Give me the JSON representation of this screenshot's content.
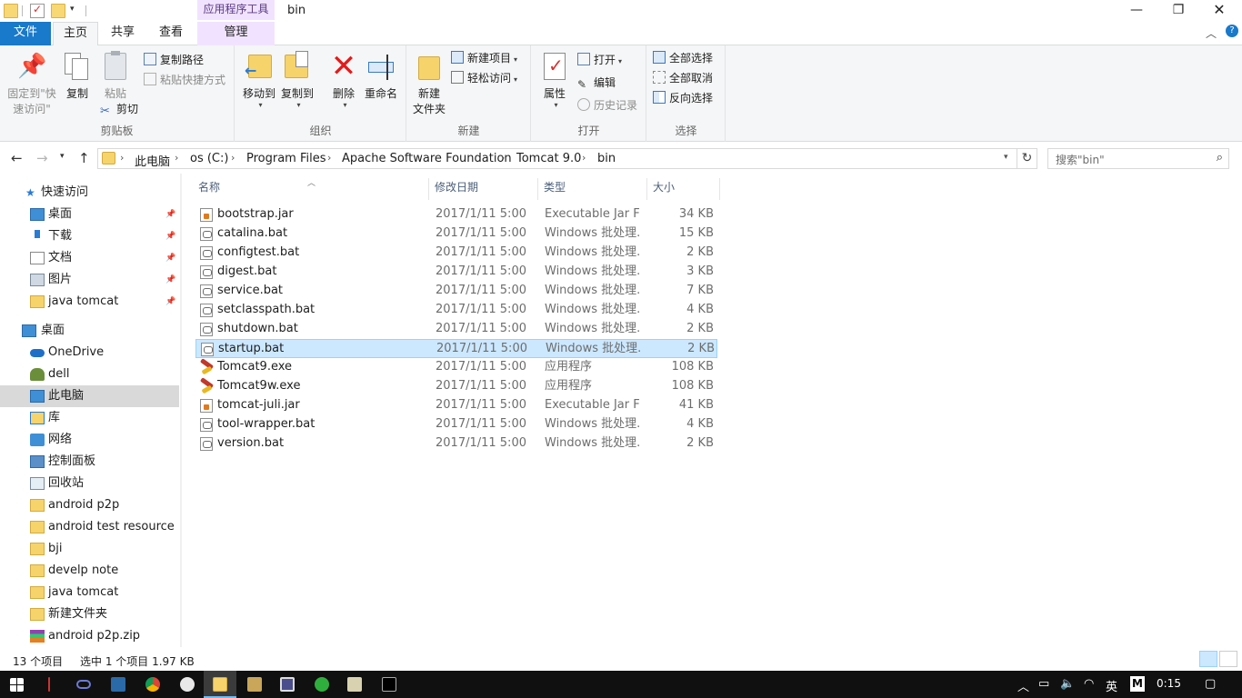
{
  "window": {
    "title": "bin",
    "context_tab_title": "应用程序工具",
    "minimize_icon": "minimize-icon",
    "maximize_icon": "restore-icon",
    "close_icon": "close-icon"
  },
  "ribbon_tabs": {
    "file": "文件",
    "home": "主页",
    "share": "共享",
    "view": "查看",
    "manage": "管理",
    "active": "主页"
  },
  "ribbon": {
    "clipboard": {
      "label": "剪贴板",
      "pin_quick_access_line1": "固定到\"快",
      "pin_quick_access_line2": "速访问\"",
      "copy": "复制",
      "paste": "粘贴",
      "copy_path": "复制路径",
      "paste_shortcut": "粘贴快捷方式",
      "cut": "剪切"
    },
    "organize": {
      "label": "组织",
      "move_to": "移动到",
      "copy_to": "复制到",
      "delete": "删除",
      "rename": "重命名"
    },
    "new": {
      "label": "新建",
      "new_folder_line1": "新建",
      "new_folder_line2": "文件夹",
      "new_item": "新建项目",
      "easy_access": "轻松访问"
    },
    "open": {
      "label": "打开",
      "properties": "属性",
      "open": "打开",
      "edit": "编辑",
      "history": "历史记录"
    },
    "select": {
      "label": "选择",
      "select_all": "全部选择",
      "select_none": "全部取消",
      "invert_selection": "反向选择"
    }
  },
  "address": {
    "breadcrumbs": [
      "此电脑",
      "os (C:)",
      "Program Files",
      "Apache Software Foundation",
      "Tomcat 9.0",
      "bin"
    ],
    "search_placeholder": "搜索\"bin\""
  },
  "navpane": {
    "quick_access": "快速访问",
    "items": [
      {
        "label": "桌面",
        "icon": "desktop-icon",
        "pinned": true
      },
      {
        "label": "下载",
        "icon": "download-icon",
        "pinned": true
      },
      {
        "label": "文档",
        "icon": "documents-icon",
        "pinned": true
      },
      {
        "label": "图片",
        "icon": "pictures-icon",
        "pinned": true
      },
      {
        "label": "java tomcat",
        "icon": "folder-icon",
        "pinned": true
      },
      {
        "label": "桌面",
        "icon": "desktop-icon"
      },
      {
        "label": "OneDrive",
        "icon": "onedrive-icon"
      },
      {
        "label": "dell",
        "icon": "user-icon"
      },
      {
        "label": "此电脑",
        "icon": "computer-icon",
        "selected": true
      },
      {
        "label": "库",
        "icon": "library-icon"
      },
      {
        "label": "网络",
        "icon": "network-icon"
      },
      {
        "label": "控制面板",
        "icon": "control-panel-icon"
      },
      {
        "label": "回收站",
        "icon": "recycle-bin-icon"
      },
      {
        "label": "android p2p",
        "icon": "folder-icon"
      },
      {
        "label": "android test  resource",
        "icon": "folder-icon"
      },
      {
        "label": "bji",
        "icon": "folder-icon"
      },
      {
        "label": "develp note",
        "icon": "folder-icon"
      },
      {
        "label": "java tomcat",
        "icon": "folder-icon"
      },
      {
        "label": "新建文件夹",
        "icon": "folder-icon"
      },
      {
        "label": "android p2p.zip",
        "icon": "zip-archive-icon"
      }
    ]
  },
  "filelist": {
    "columns": {
      "name": "名称",
      "date": "修改日期",
      "type": "类型",
      "size": "大小"
    },
    "files": [
      {
        "name": "bootstrap.jar",
        "date": "2017/1/11 5:00",
        "type": "Executable Jar File",
        "size": "34 KB",
        "icon": "jar"
      },
      {
        "name": "catalina.bat",
        "date": "2017/1/11 5:00",
        "type": "Windows 批处理...",
        "size": "15 KB",
        "icon": "bat"
      },
      {
        "name": "configtest.bat",
        "date": "2017/1/11 5:00",
        "type": "Windows 批处理...",
        "size": "2 KB",
        "icon": "bat"
      },
      {
        "name": "digest.bat",
        "date": "2017/1/11 5:00",
        "type": "Windows 批处理...",
        "size": "3 KB",
        "icon": "bat"
      },
      {
        "name": "service.bat",
        "date": "2017/1/11 5:00",
        "type": "Windows 批处理...",
        "size": "7 KB",
        "icon": "bat"
      },
      {
        "name": "setclasspath.bat",
        "date": "2017/1/11 5:00",
        "type": "Windows 批处理...",
        "size": "4 KB",
        "icon": "bat"
      },
      {
        "name": "shutdown.bat",
        "date": "2017/1/11 5:00",
        "type": "Windows 批处理...",
        "size": "2 KB",
        "icon": "bat"
      },
      {
        "name": "startup.bat",
        "date": "2017/1/11 5:00",
        "type": "Windows 批处理...",
        "size": "2 KB",
        "icon": "bat",
        "selected": true
      },
      {
        "name": "Tomcat9.exe",
        "date": "2017/1/11 5:00",
        "type": "应用程序",
        "size": "108 KB",
        "icon": "exe"
      },
      {
        "name": "Tomcat9w.exe",
        "date": "2017/1/11 5:00",
        "type": "应用程序",
        "size": "108 KB",
        "icon": "exe"
      },
      {
        "name": "tomcat-juli.jar",
        "date": "2017/1/11 5:00",
        "type": "Executable Jar File",
        "size": "41 KB",
        "icon": "jar"
      },
      {
        "name": "tool-wrapper.bat",
        "date": "2017/1/11 5:00",
        "type": "Windows 批处理...",
        "size": "4 KB",
        "icon": "bat"
      },
      {
        "name": "version.bat",
        "date": "2017/1/11 5:00",
        "type": "Windows 批处理...",
        "size": "2 KB",
        "icon": "bat"
      }
    ]
  },
  "status": {
    "item_count": "13 个项目",
    "selection": "选中 1 个项目  1.97 KB"
  },
  "taskbar": {
    "clock": "0:15",
    "ime": "M"
  },
  "colors": {
    "file_tab": "#1979ca",
    "manage_tab": "#f1e3ff",
    "selection": "#cce8ff",
    "selection_border": "#99d1ff",
    "taskbar": "#101010"
  }
}
